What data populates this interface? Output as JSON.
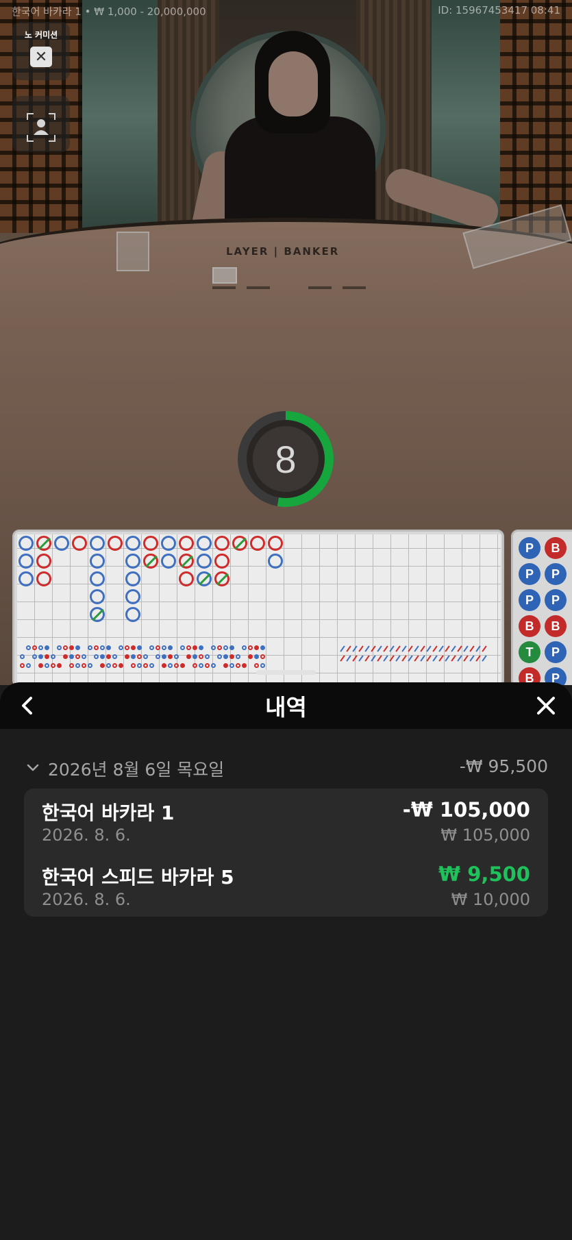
{
  "game_header": {
    "table_info": "한국어 바카라 1 • ₩ 1,000 - 20,000,000",
    "session_id": "ID: 15967453417 08:41"
  },
  "side_controls": {
    "no_commission_label": "노 커미션",
    "close_icon": "close-icon",
    "profile_icon": "user-frame-icon"
  },
  "table": {
    "felt_label": "LAYER | BANKER",
    "countdown": "8",
    "countdown_remaining_fraction": 0.53
  },
  "roadmap": {
    "side_beads": [
      "P",
      "B",
      "P",
      "P",
      "P",
      "P",
      "B",
      "B",
      "T",
      "P",
      "B",
      "P"
    ]
  },
  "history_sheet": {
    "title": "내역",
    "back_icon": "chevron-left-icon",
    "close_icon": "close-icon",
    "groups": [
      {
        "date": "2026년 8월 6일 목요일",
        "total": "-₩ 95,500",
        "items": [
          {
            "name": "한국어 바카라 1",
            "date": "2026. 8. 6.",
            "result": "-₩ 105,000",
            "stake": "₩ 105,000",
            "win": false
          },
          {
            "name": "한국어 스피드 바카라 5",
            "date": "2026. 8. 6.",
            "result": "₩ 9,500",
            "stake": "₩ 10,000",
            "win": true
          }
        ]
      }
    ]
  },
  "colors": {
    "win_green": "#1fc25a",
    "timer_green": "#17a53d",
    "player_blue": "#2f63b5",
    "banker_red": "#c32a2a",
    "tie_green": "#238a3e"
  }
}
